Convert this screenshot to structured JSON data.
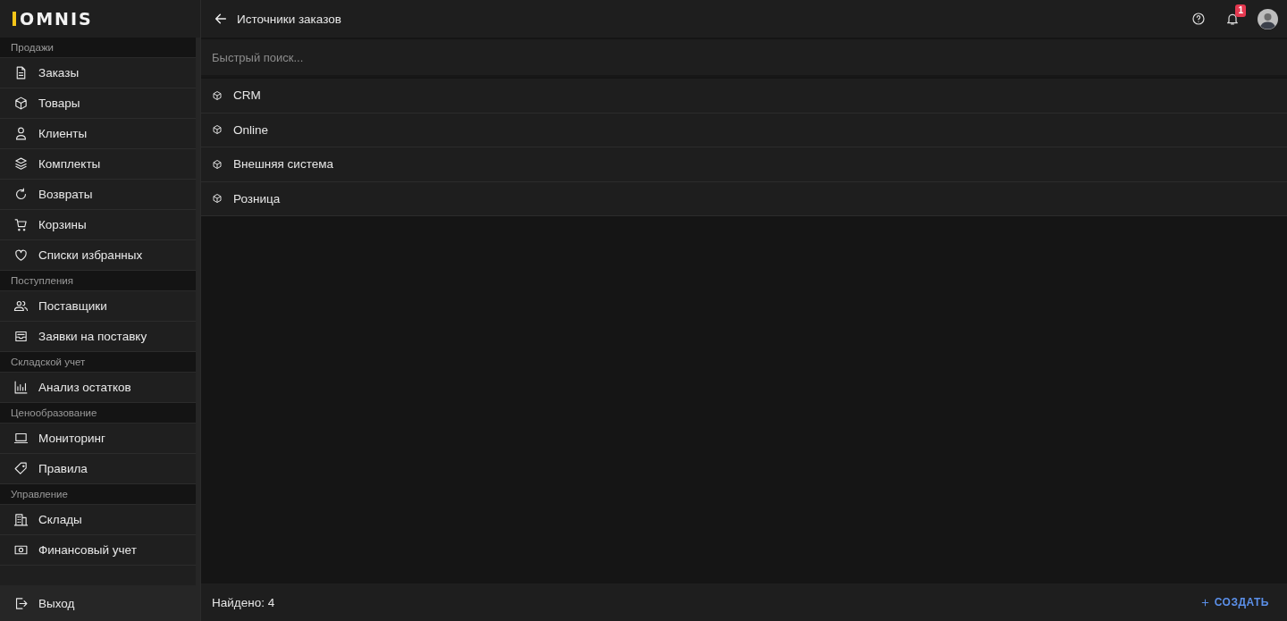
{
  "logo": "OMNIS",
  "sidebar": {
    "sections": [
      {
        "title": "Продажи",
        "items": [
          {
            "label": "Заказы",
            "kind": "file"
          },
          {
            "label": "Товары",
            "kind": "box"
          },
          {
            "label": "Клиенты",
            "kind": "user"
          },
          {
            "label": "Комплекты",
            "kind": "layers"
          },
          {
            "label": "Возвраты",
            "kind": "refresh"
          },
          {
            "label": "Корзины",
            "kind": "cart"
          },
          {
            "label": "Списки избранных",
            "kind": "heart"
          }
        ]
      },
      {
        "title": "Поступления",
        "items": [
          {
            "label": "Поставщики",
            "kind": "users"
          },
          {
            "label": "Заявки на поставку",
            "kind": "inbox"
          }
        ]
      },
      {
        "title": "Складской учет",
        "items": [
          {
            "label": "Анализ остатков",
            "kind": "chart"
          }
        ]
      },
      {
        "title": "Ценообразование",
        "items": [
          {
            "label": "Мониторинг",
            "kind": "laptop"
          },
          {
            "label": "Правила",
            "kind": "tag"
          }
        ]
      },
      {
        "title": "Управление",
        "items": [
          {
            "label": "Склады",
            "kind": "building"
          },
          {
            "label": "Финансовый учет",
            "kind": "money"
          }
        ]
      }
    ]
  },
  "logout": {
    "label": "Выход"
  },
  "header": {
    "title": "Источники заказов",
    "notifications": "1"
  },
  "search": {
    "placeholder": "Быстрый поиск..."
  },
  "sources": [
    {
      "label": "CRM"
    },
    {
      "label": "Online"
    },
    {
      "label": "Внешняя система"
    },
    {
      "label": "Розница"
    }
  ],
  "footer": {
    "count": "Найдено: 4",
    "create": "СОЗДАТЬ"
  }
}
